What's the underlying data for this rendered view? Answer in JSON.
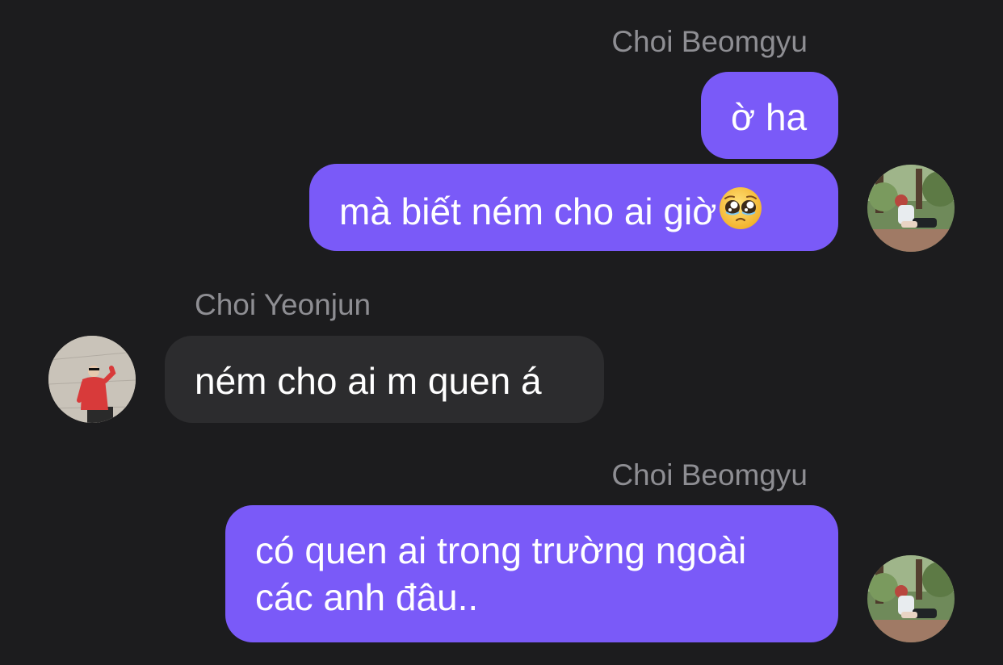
{
  "messages": [
    {
      "sender": "Choi Beomgyu",
      "direction": "outgoing",
      "text": "ờ ha"
    },
    {
      "sender": "Choi Beomgyu",
      "direction": "outgoing",
      "text": "mà biết ném cho ai giờ",
      "emoji": "pleading-face-emoji"
    },
    {
      "sender": "Choi Yeonjun",
      "direction": "incoming",
      "text": "ném cho ai m quen á"
    },
    {
      "sender": "Choi Beomgyu",
      "direction": "outgoing",
      "line1": "có quen ai trong trường ngoài",
      "line2": "các anh đâu.."
    }
  ],
  "colors": {
    "background": "#1c1c1e",
    "outgoing_bubble": "#7a5af8",
    "incoming_bubble": "#2c2c2e",
    "sender_name": "#8e8e93",
    "message_text": "#ffffff"
  }
}
